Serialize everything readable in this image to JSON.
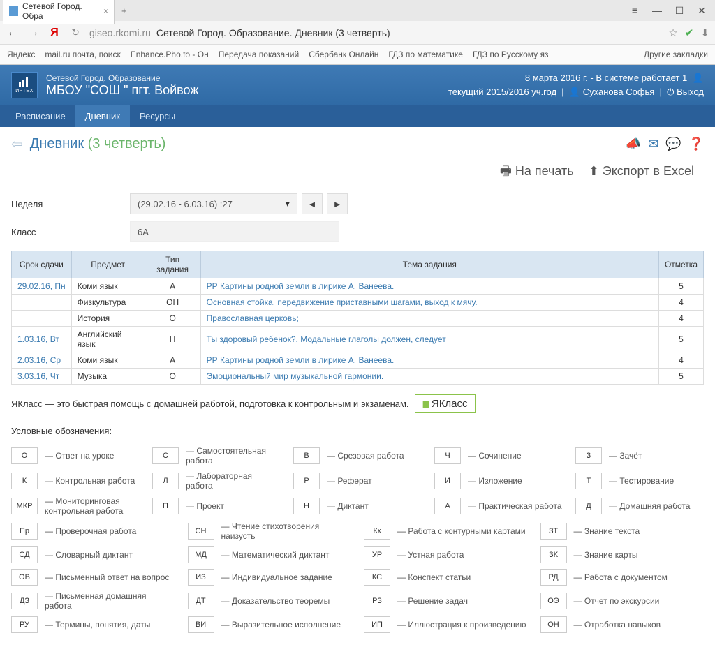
{
  "browser": {
    "tab_title": "Сетевой Город. Обра",
    "url_domain": "giseo.rkomi.ru",
    "url_title": "Сетевой Город. Образование. Дневник (3 четверть)",
    "bookmarks": [
      "Яндекс",
      "mail.ru почта, поиск",
      "Enhance.Pho.to - Он",
      "Передача показаний",
      "Сбербанк Онлайн",
      "ГДЗ по математике",
      "ГДЗ по Русскому яз"
    ],
    "more_bookmarks": "Другие закладки"
  },
  "header": {
    "system": "Сетевой Город. Образование",
    "school": "МБОУ \"СОШ \" пгт. Войвож",
    "logo": "ИРТЕХ",
    "date_info": "8 марта 2016 г. - В системе работает 1",
    "year": "текущий 2015/2016 уч.год",
    "user": "Суханова Софья",
    "exit": "Выход"
  },
  "nav": {
    "items": [
      "Расписание",
      "Дневник",
      "Ресурсы"
    ],
    "active": 1
  },
  "page": {
    "title": "Дневник",
    "term": "(3 четверть)"
  },
  "actions": {
    "print": "На печать",
    "export": "Экспорт в Excel"
  },
  "filters": {
    "week_label": "Неделя",
    "week_value": "(29.02.16 - 6.03.16) :27",
    "class_label": "Класс",
    "class_value": "6А"
  },
  "table": {
    "headers": [
      "Срок сдачи",
      "Предмет",
      "Тип задания",
      "Тема задания",
      "Отметка"
    ],
    "rows": [
      {
        "date": "29.02.16, Пн",
        "subject": "Коми язык",
        "type": "А",
        "topic": "РР Картины родной земли в лирике А. Ванеева.",
        "mark": "5"
      },
      {
        "date": "",
        "subject": "Физкультура",
        "type": "ОН",
        "topic": "Основная стойка, передвижение приставными шагами, выход к мячу.",
        "mark": "4"
      },
      {
        "date": "",
        "subject": "История",
        "type": "О",
        "topic": "Православная церковь;",
        "mark": "4"
      },
      {
        "date": "1.03.16, Вт",
        "subject": "Английский язык",
        "type": "Н",
        "topic": "Ты здоровый ребенок?. Модальные глаголы должен, следует",
        "mark": "5"
      },
      {
        "date": "2.03.16, Ср",
        "subject": "Коми язык",
        "type": "А",
        "topic": "РР Картины родной земли в лирике А. Ванеева.",
        "mark": "4"
      },
      {
        "date": "3.03.16, Чт",
        "subject": "Музыка",
        "type": "О",
        "topic": "Эмоциональный мир музыкальной гармонии.",
        "mark": "5"
      }
    ]
  },
  "yaklass": {
    "text": "ЯКласс — это быстрая помощь с домашней работой, подготовка к контрольным и экзаменам.",
    "badge": "ЯКласс"
  },
  "legend": {
    "title": "Условные обозначения:",
    "block1": [
      {
        "code": "О",
        "desc": "Ответ на уроке"
      },
      {
        "code": "С",
        "desc": "Самостоятельная работа"
      },
      {
        "code": "В",
        "desc": "Срезовая работа"
      },
      {
        "code": "Ч",
        "desc": "Сочинение"
      },
      {
        "code": "З",
        "desc": "Зачёт"
      },
      {
        "code": "К",
        "desc": "Контрольная работа"
      },
      {
        "code": "Л",
        "desc": "Лабораторная работа"
      },
      {
        "code": "Р",
        "desc": "Реферат"
      },
      {
        "code": "И",
        "desc": "Изложение"
      },
      {
        "code": "Т",
        "desc": "Тестирование"
      },
      {
        "code": "МКР",
        "desc": "Мониторинговая контрольная работа"
      },
      {
        "code": "П",
        "desc": "Проект"
      },
      {
        "code": "Н",
        "desc": "Диктант"
      },
      {
        "code": "А",
        "desc": "Практическая работа"
      },
      {
        "code": "Д",
        "desc": "Домашняя работа"
      }
    ],
    "block2": [
      {
        "code": "Пр",
        "desc": "Проверочная работа"
      },
      {
        "code": "СН",
        "desc": "Чтение стихотворения наизусть"
      },
      {
        "code": "Кк",
        "desc": "Работа с контурными картами"
      },
      {
        "code": "ЗТ",
        "desc": "Знание текста"
      },
      {
        "code": "СД",
        "desc": "Словарный диктант"
      },
      {
        "code": "МД",
        "desc": "Математический диктант"
      },
      {
        "code": "УР",
        "desc": "Устная работа"
      },
      {
        "code": "ЗК",
        "desc": "Знание карты"
      },
      {
        "code": "ОВ",
        "desc": "Письменный ответ на вопрос"
      },
      {
        "code": "ИЗ",
        "desc": "Индивидуальное задание"
      },
      {
        "code": "КС",
        "desc": "Конспект статьи"
      },
      {
        "code": "РД",
        "desc": "Работа с документом"
      },
      {
        "code": "ДЗ",
        "desc": "Письменная домашняя работа"
      },
      {
        "code": "ДТ",
        "desc": "Доказательство теоремы"
      },
      {
        "code": "РЗ",
        "desc": "Решение задач"
      },
      {
        "code": "ОЭ",
        "desc": "Отчет по экскурсии"
      },
      {
        "code": "РУ",
        "desc": "Термины, понятия, даты"
      },
      {
        "code": "ВИ",
        "desc": "Выразительное исполнение"
      },
      {
        "code": "ИП",
        "desc": "Иллюстрация к произведению"
      },
      {
        "code": "ОН",
        "desc": "Отработка навыков"
      }
    ]
  }
}
